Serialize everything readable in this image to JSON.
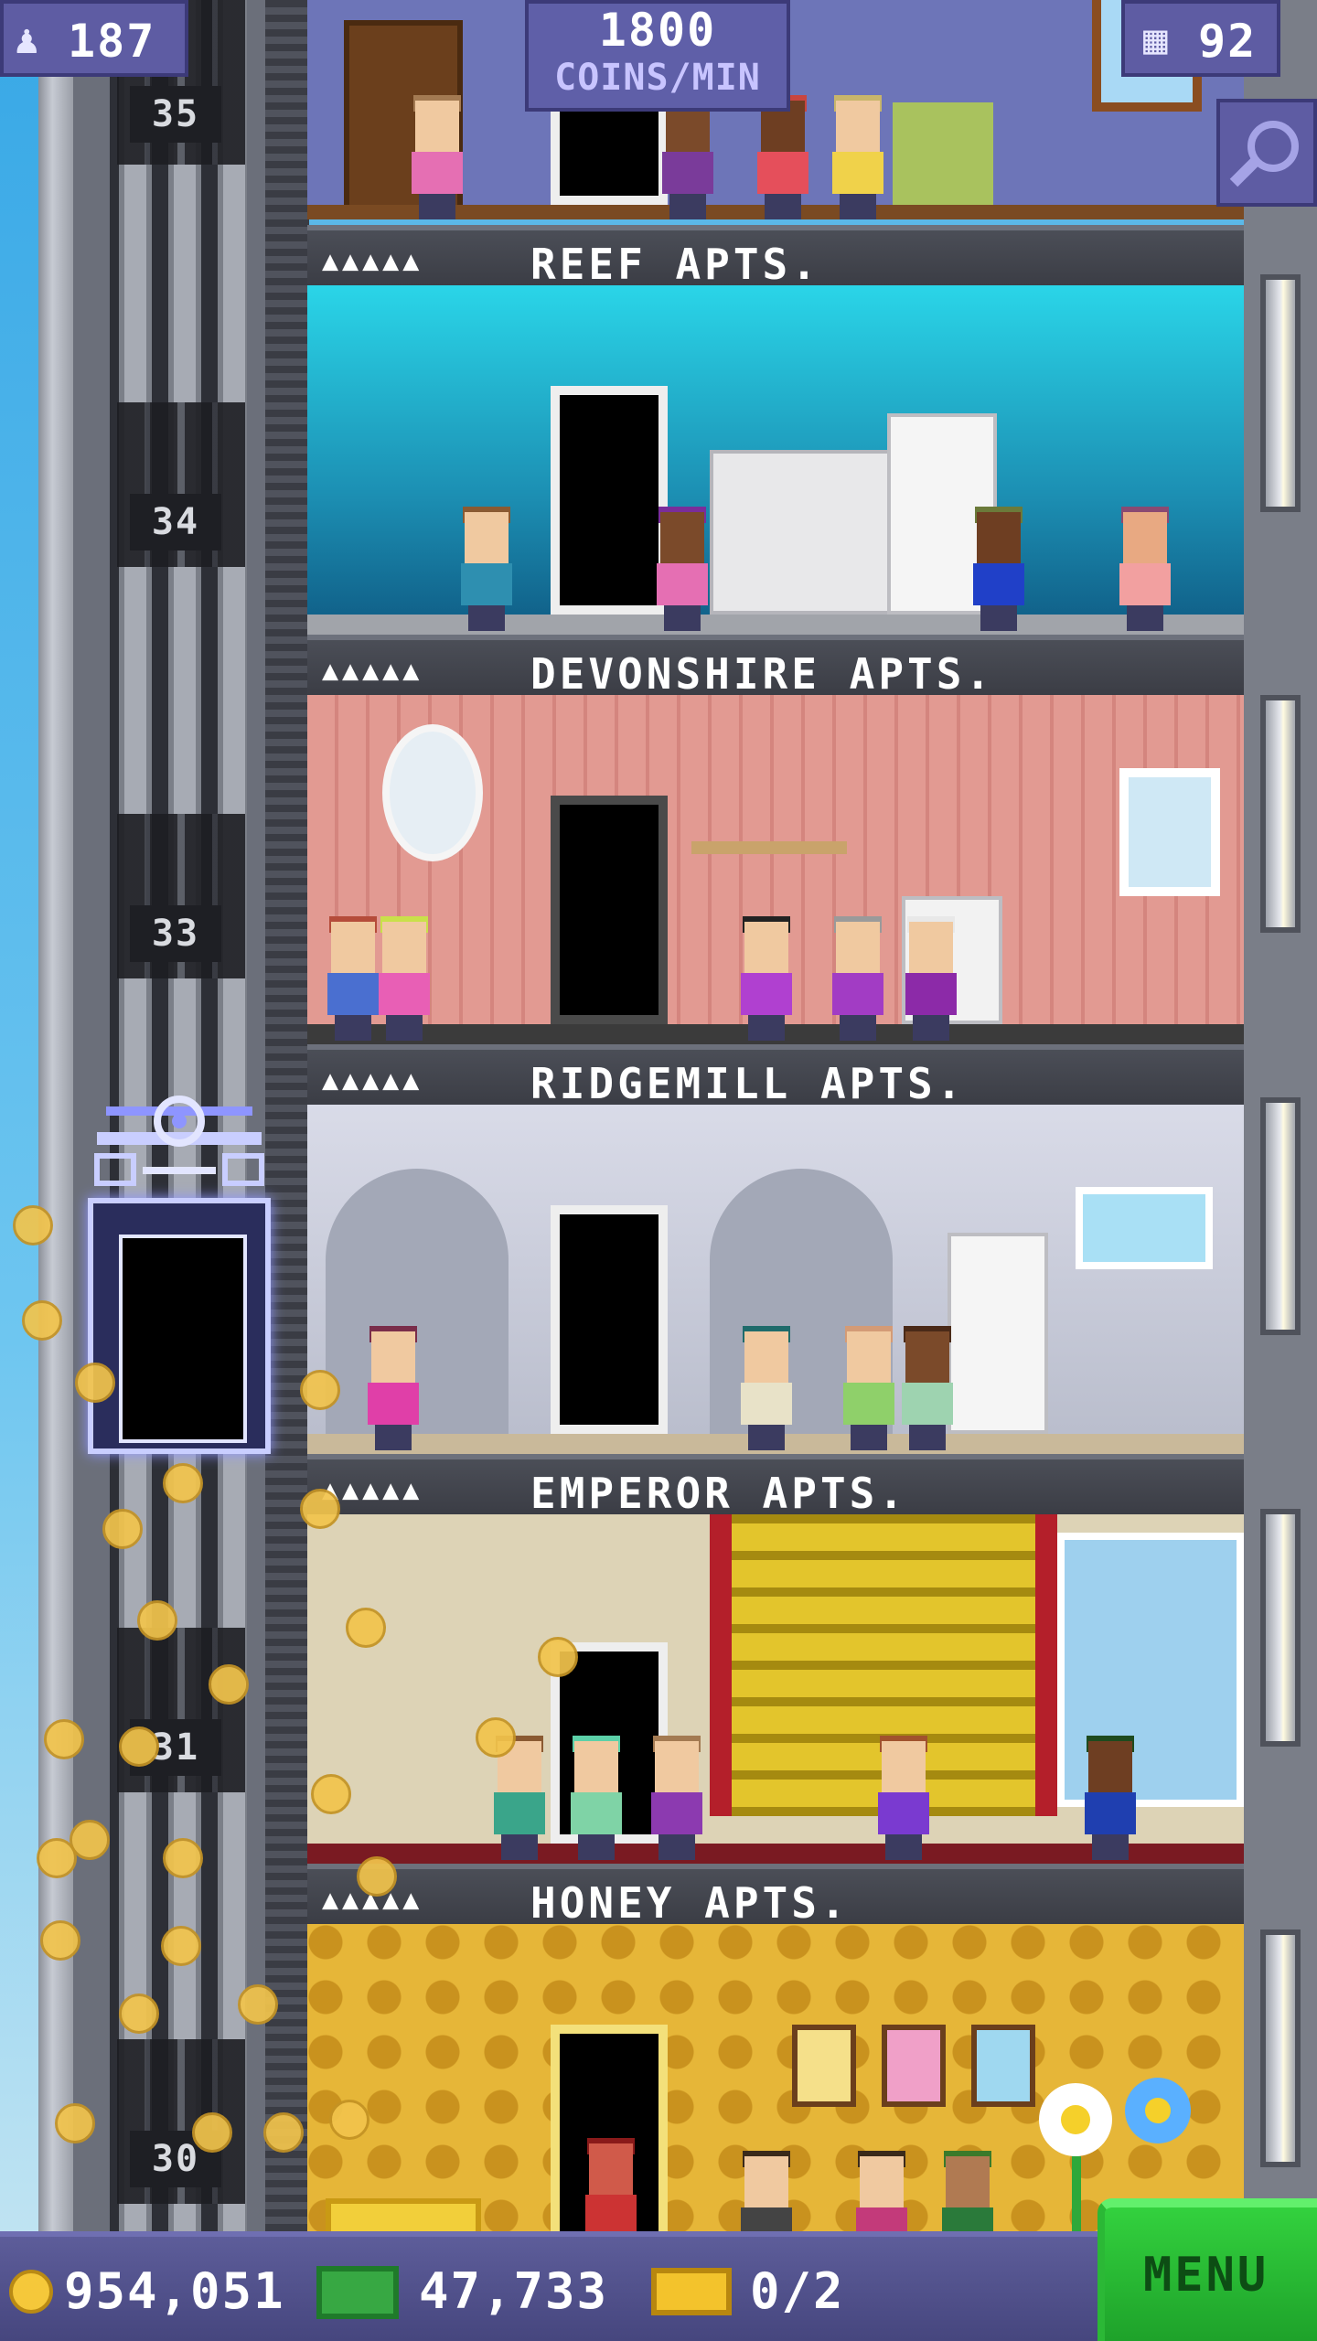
{
  "hud": {
    "population": "187",
    "coins_rate_value": "1800",
    "coins_rate_unit": "COINS/MIN",
    "floor_count": "92",
    "population_icon": "person-icon",
    "floors_icon": "building-icon",
    "search_icon": "magnifier-icon"
  },
  "shaft": {
    "floor_numbers": [
      "35",
      "34",
      "33",
      "31",
      "30"
    ]
  },
  "floors": [
    {
      "name": "REEF APTS.",
      "pips": "▲▲▲▲▲",
      "theme_color": "#2bbfd9"
    },
    {
      "name": "DEVONSHIRE APTS.",
      "pips": "▲▲▲▲▲",
      "theme_color": "#d98e86"
    },
    {
      "name": "RIDGEMILL APTS.",
      "pips": "▲▲▲▲▲",
      "theme_color": "#b7bccb"
    },
    {
      "name": "EMPEROR APTS.",
      "pips": "▲▲▲▲▲",
      "theme_color": "#d8cfb2"
    },
    {
      "name": "HONEY APTS.",
      "pips": "▲▲▲▲▲",
      "theme_color": "#e2b233"
    }
  ],
  "bottom_bar": {
    "coins": "954,051",
    "bux": "47,733",
    "tickets": "0/2",
    "menu_label": "MENU",
    "coin_icon": "coin-icon",
    "bux_icon": "bux-icon",
    "ticket_icon": "ticket-icon"
  },
  "colors": {
    "hud_bg": "#5e5ca3",
    "menu_green": "#22b32e",
    "sky": "#5bb8e8"
  }
}
